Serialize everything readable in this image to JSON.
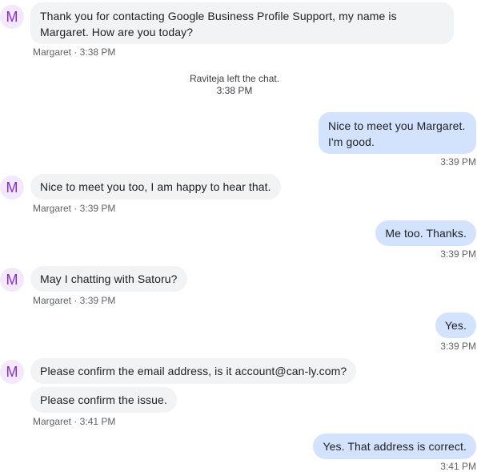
{
  "avatar_letter": "M",
  "colors": {
    "agent_bubble": "#f1f3f4",
    "user_bubble": "#d3e3fd",
    "avatar_bg": "#f3e8fd",
    "avatar_text": "#8430ce",
    "meta_text": "#5f6368"
  },
  "chat": {
    "m1": {
      "text": "Thank you for contacting Google Business Profile Support, my name is\nMargaret. How are you today?",
      "meta": "Margaret · 3:38 PM"
    },
    "system": {
      "line1": "Raviteja left the chat.",
      "line2": "3:38 PM"
    },
    "u1": {
      "text": "Nice to meet you Margaret.\nI'm good.",
      "time": "3:39 PM"
    },
    "m2": {
      "text": "Nice to meet you too, I am happy to hear that.",
      "meta": "Margaret · 3:39 PM"
    },
    "u2": {
      "text": "Me too. Thanks.",
      "time": "3:39 PM"
    },
    "m3": {
      "text": "May I chatting with Satoru?",
      "meta": "Margaret · 3:39 PM"
    },
    "u3": {
      "text": "Yes.",
      "time": "3:39 PM"
    },
    "m4": {
      "text": "Please confirm the email address, is it account@can-ly.com?"
    },
    "m5": {
      "text": "Please confirm the issue.",
      "meta": "Margaret · 3:41 PM"
    },
    "u4": {
      "text": "Yes. That address is correct.",
      "time": "3:41 PM"
    }
  }
}
